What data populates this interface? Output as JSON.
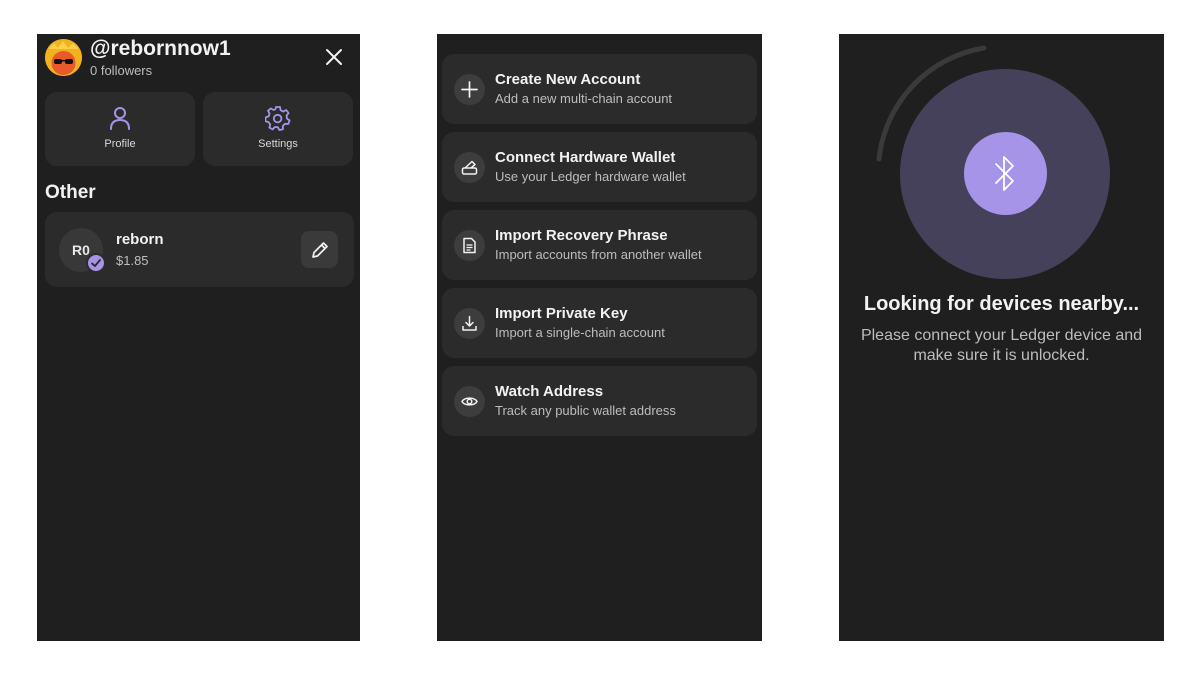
{
  "profile_screen": {
    "username": "@rebornnow1",
    "followers": "0 followers",
    "tiles": [
      {
        "label": "Profile",
        "icon": "person-icon"
      },
      {
        "label": "Settings",
        "icon": "gear-icon"
      }
    ],
    "section_title": "Other",
    "account": {
      "initials": "R0",
      "name": "reborn",
      "balance": "$1.85"
    }
  },
  "add_account_screen": {
    "options": [
      {
        "title": "Create New Account",
        "subtitle": "Add a new multi-chain account",
        "icon": "plus-icon"
      },
      {
        "title": "Connect Hardware Wallet",
        "subtitle": "Use your Ledger hardware wallet",
        "icon": "hardware-wallet-icon"
      },
      {
        "title": "Import Recovery Phrase",
        "subtitle": "Import accounts from another wallet",
        "icon": "document-icon"
      },
      {
        "title": "Import Private Key",
        "subtitle": "Import a single-chain account",
        "icon": "download-icon"
      },
      {
        "title": "Watch Address",
        "subtitle": "Track any public wallet address",
        "icon": "eye-icon"
      }
    ]
  },
  "ledger_screen": {
    "title": "Looking for devices nearby...",
    "subtitle": "Please connect your Ledger device and make sure it is unlocked."
  },
  "colors": {
    "screen_bg": "#1f1f1f",
    "card_bg": "#2b2b2b",
    "accent": "#a594e8",
    "pulse": "#45415a"
  }
}
